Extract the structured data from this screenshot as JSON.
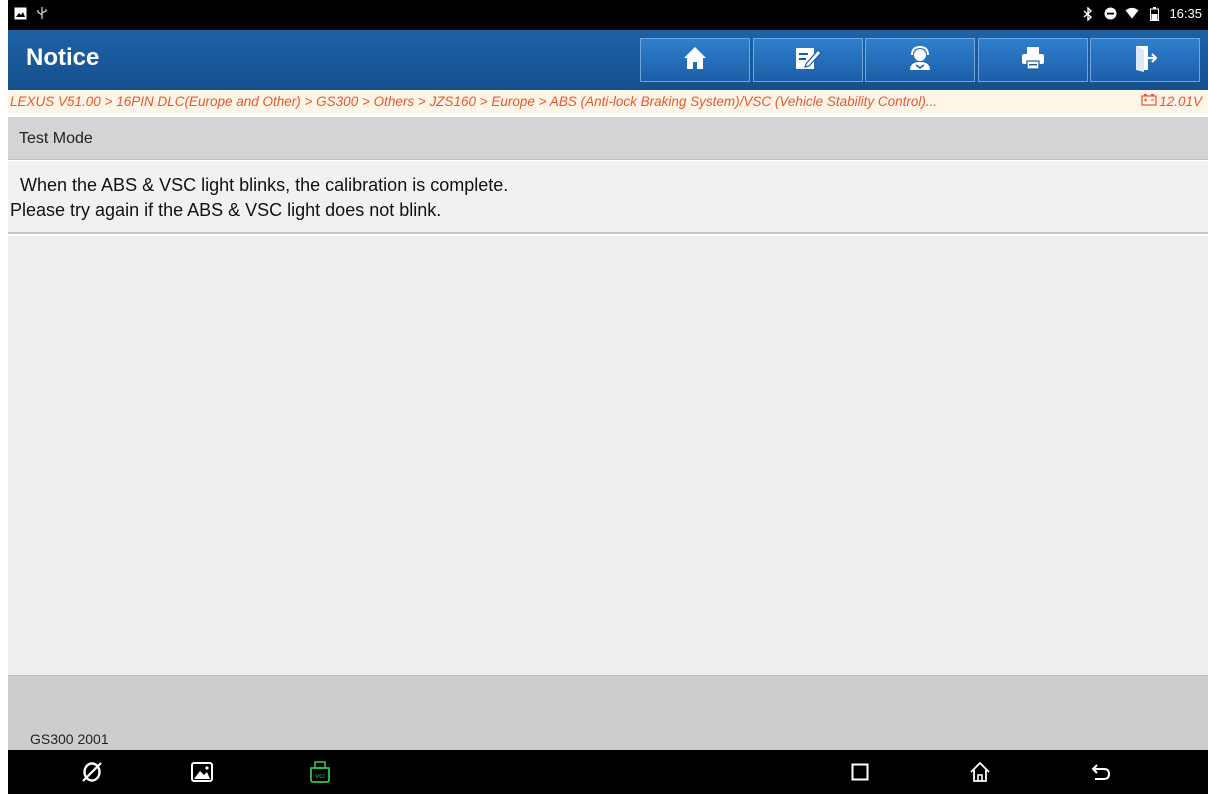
{
  "status_bar": {
    "time": "16:35",
    "left_icons": [
      "gallery-icon",
      "usb-icon"
    ],
    "right_icons": [
      "bluetooth-icon",
      "do-not-disturb-icon",
      "wifi-icon",
      "battery-icon"
    ]
  },
  "header": {
    "title": "Notice",
    "buttons": [
      {
        "name": "home-button",
        "icon": "home-icon"
      },
      {
        "name": "report-button",
        "icon": "edit-icon"
      },
      {
        "name": "support-button",
        "icon": "support-person-icon"
      },
      {
        "name": "print-button",
        "icon": "printer-icon"
      },
      {
        "name": "exit-button",
        "icon": "exit-icon"
      }
    ]
  },
  "breadcrumb": {
    "path": "LEXUS V51.00 > 16PIN DLC(Europe and Other) > GS300 > Others > JZS160 > Europe > ABS (Anti-lock Braking System)/VSC (Vehicle Stability Control)...",
    "voltage": "12.01V",
    "color": "#e8572b"
  },
  "section": {
    "title": "Test Mode"
  },
  "message": {
    "line1": "When the ABS & VSC light blinks, the calibration is complete.",
    "line2": "Please try again if the ABS & VSC light does not blink."
  },
  "footer": {
    "vehicle": "GS300 2001"
  },
  "nav_bar": {
    "left_icons": [
      "browser-icon",
      "gallery-icon",
      "vci-icon"
    ],
    "right_icons": [
      "recents-icon",
      "home-icon",
      "back-icon"
    ],
    "vci_color": "#33c24a"
  }
}
